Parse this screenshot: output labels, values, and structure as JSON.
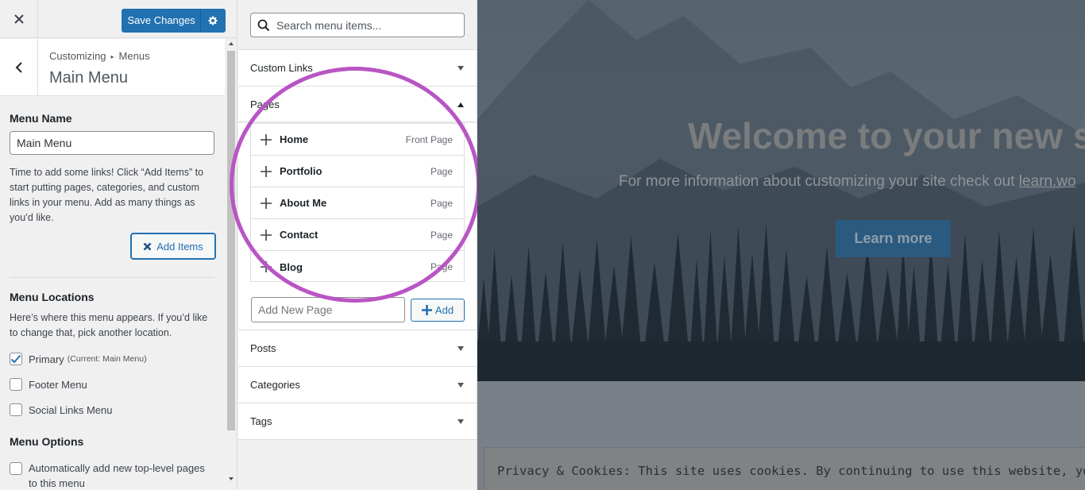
{
  "header": {
    "save_label": "Save Changes"
  },
  "panel": {
    "breadcrumb_root": "Customizing",
    "breadcrumb_parent": "Menus",
    "title": "Main Menu"
  },
  "menu_name": {
    "label": "Menu Name",
    "value": "Main Menu"
  },
  "instructions": "Time to add some links! Click “Add Items” to start putting pages, categories, and custom links in your menu. Add as many things as you’d like.",
  "add_items_label": "Add Items",
  "locations": {
    "label": "Menu Locations",
    "description": "Here’s where this menu appears. If you’d like to change that, pick another location.",
    "items": [
      {
        "label": "Primary",
        "note": "(Current: Main Menu)",
        "checked": true
      },
      {
        "label": "Footer Menu",
        "note": "",
        "checked": false
      },
      {
        "label": "Social Links Menu",
        "note": "",
        "checked": false
      }
    ]
  },
  "options": {
    "label": "Menu Options",
    "auto_add": "Automatically add new top-level pages to this menu"
  },
  "items_panel": {
    "search_placeholder": "Search menu items...",
    "sections": [
      "Custom Links",
      "Pages",
      "Posts",
      "Categories",
      "Tags"
    ],
    "pages": [
      {
        "name": "Home",
        "type": "Front Page"
      },
      {
        "name": "Portfolio",
        "type": "Page"
      },
      {
        "name": "About Me",
        "type": "Page"
      },
      {
        "name": "Contact",
        "type": "Page"
      },
      {
        "name": "Blog",
        "type": "Page"
      }
    ],
    "new_page_placeholder": "Add New Page",
    "add_label": "Add"
  },
  "preview": {
    "hero_title": "Welcome to your new site",
    "hero_subtitle": "For more information about customizing your site check out",
    "hero_link": "learn.wo",
    "learn_more": "Learn more",
    "cookie_text": "Privacy & Cookies: This site uses cookies. By continuing to use this website, you agree to their use."
  },
  "colors": {
    "accent": "#2271b1",
    "highlight": "#b955c4"
  }
}
